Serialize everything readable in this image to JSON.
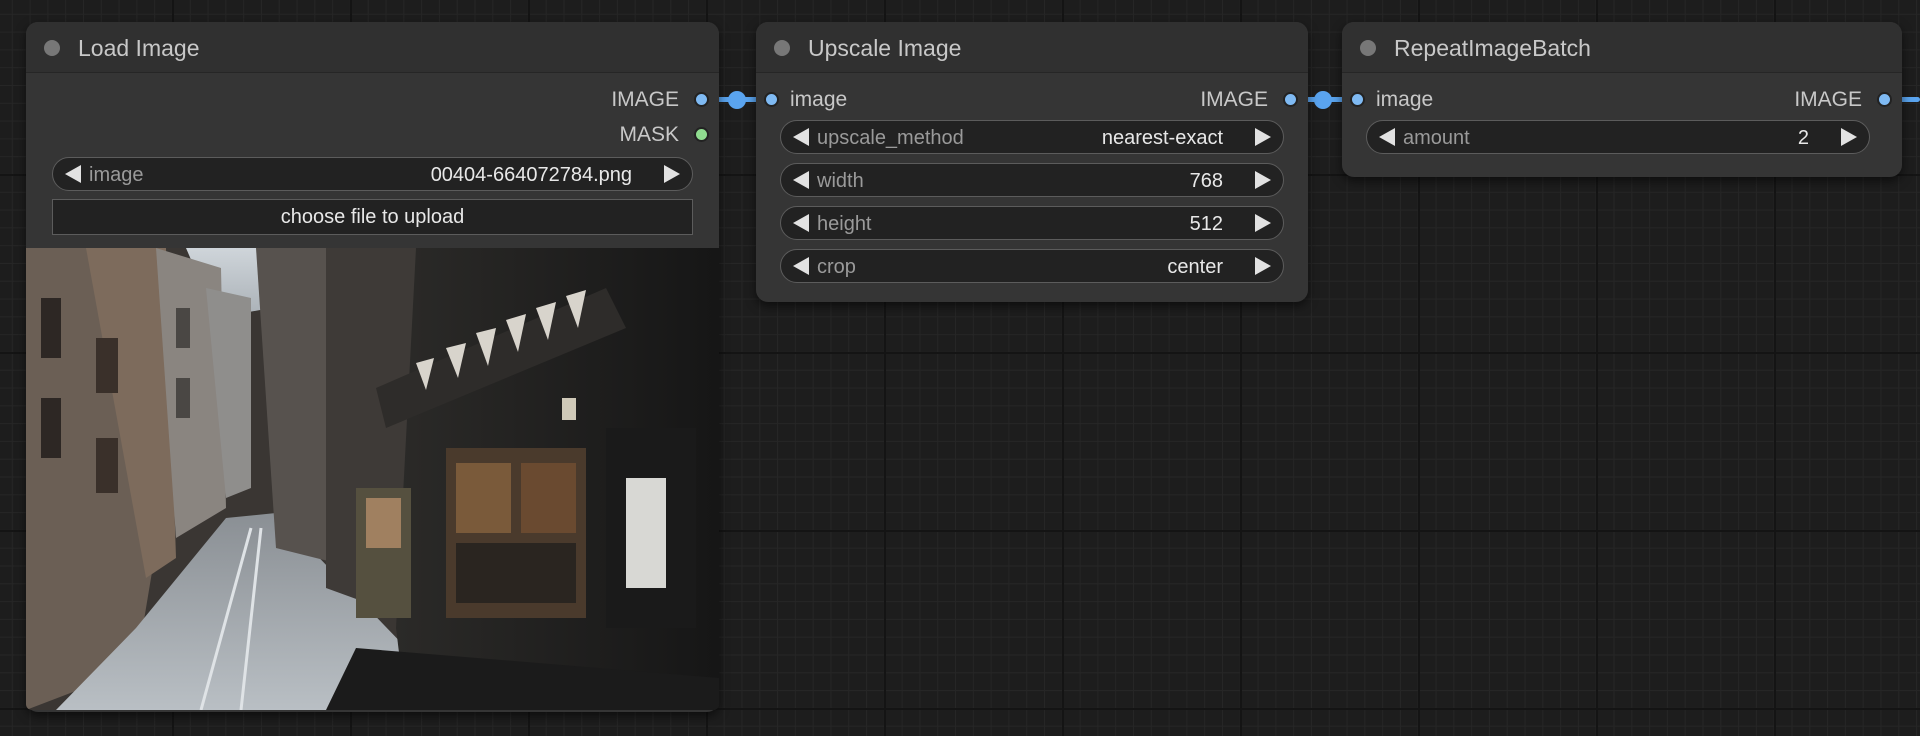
{
  "colors": {
    "image_slot": "#7fbaf3",
    "mask_slot": "#8fdc8f",
    "link": "#5aa4ef",
    "node_bg": "#353535",
    "canvas_bg": "#1d1d1d"
  },
  "load_image": {
    "title": "Load Image",
    "outputs": [
      "IMAGE",
      "MASK"
    ],
    "widget_image": {
      "label": "image",
      "value": "00404-664072784.png"
    },
    "upload_label": "choose file to upload"
  },
  "upscale_image": {
    "title": "Upscale Image",
    "input": "image",
    "output": "IMAGE",
    "widgets": [
      {
        "label": "upscale_method",
        "value": "nearest-exact"
      },
      {
        "label": "width",
        "value": "768"
      },
      {
        "label": "height",
        "value": "512"
      },
      {
        "label": "crop",
        "value": "center"
      }
    ]
  },
  "repeat_batch": {
    "title": "RepeatImageBatch",
    "input": "image",
    "output": "IMAGE",
    "widgets": [
      {
        "label": "amount",
        "value": "2"
      }
    ]
  }
}
